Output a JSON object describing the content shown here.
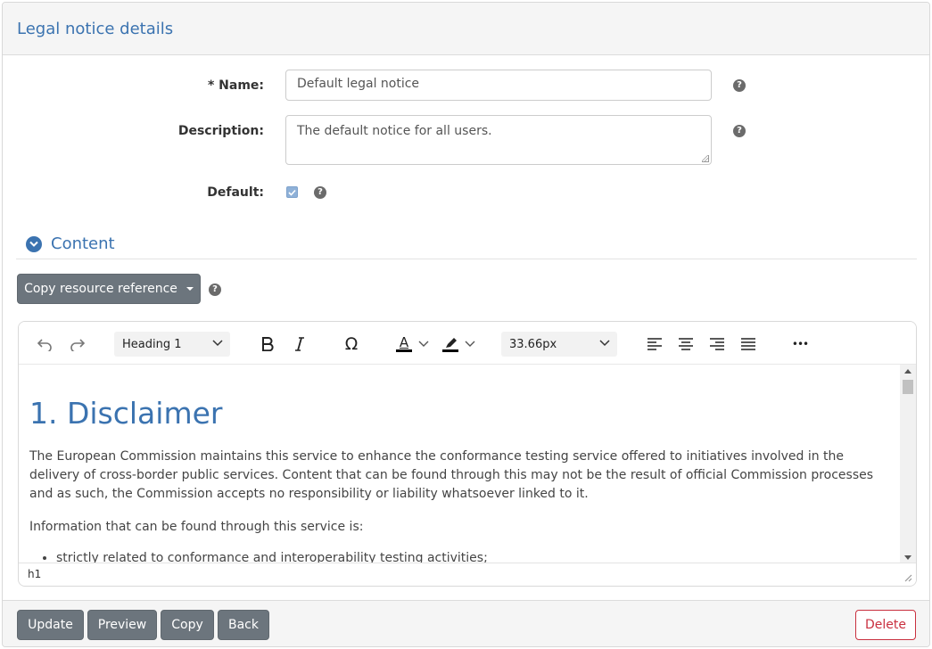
{
  "panel": {
    "title": "Legal notice details"
  },
  "form": {
    "name": {
      "label": "* Name:",
      "value": "Default legal notice"
    },
    "description": {
      "label": "Description:",
      "value": "The default notice for all users."
    },
    "default": {
      "label": "Default:",
      "checked": true
    }
  },
  "help_glyph": "?",
  "content_section": {
    "title": "Content"
  },
  "copy_reference": {
    "label": "Copy resource reference"
  },
  "editor": {
    "block_format": "Heading 1",
    "font_size": "33.66px",
    "omega": "Ω",
    "text_color_glyph": "A",
    "more_glyph": "•••",
    "heading": "1. Disclaimer",
    "paragraphs": [
      "The European Commission maintains this service to enhance the conformance testing service offered to initiatives involved in the delivery of cross-border public services. Content that can be found through this may not be the result of official Commission processes and as such, the Commission accepts no responsibility or liability whatsoever linked to it.",
      "Information that can be found through this service is:"
    ],
    "list_items": [
      "strictly related to conformance and interoperability testing activities;"
    ],
    "status_path": "h1"
  },
  "colors": {
    "accent": "#3b73b0",
    "button": "#6c757d",
    "danger": "#c9303f"
  },
  "footer": {
    "update": "Update",
    "preview": "Preview",
    "copy": "Copy",
    "back": "Back",
    "delete": "Delete"
  }
}
